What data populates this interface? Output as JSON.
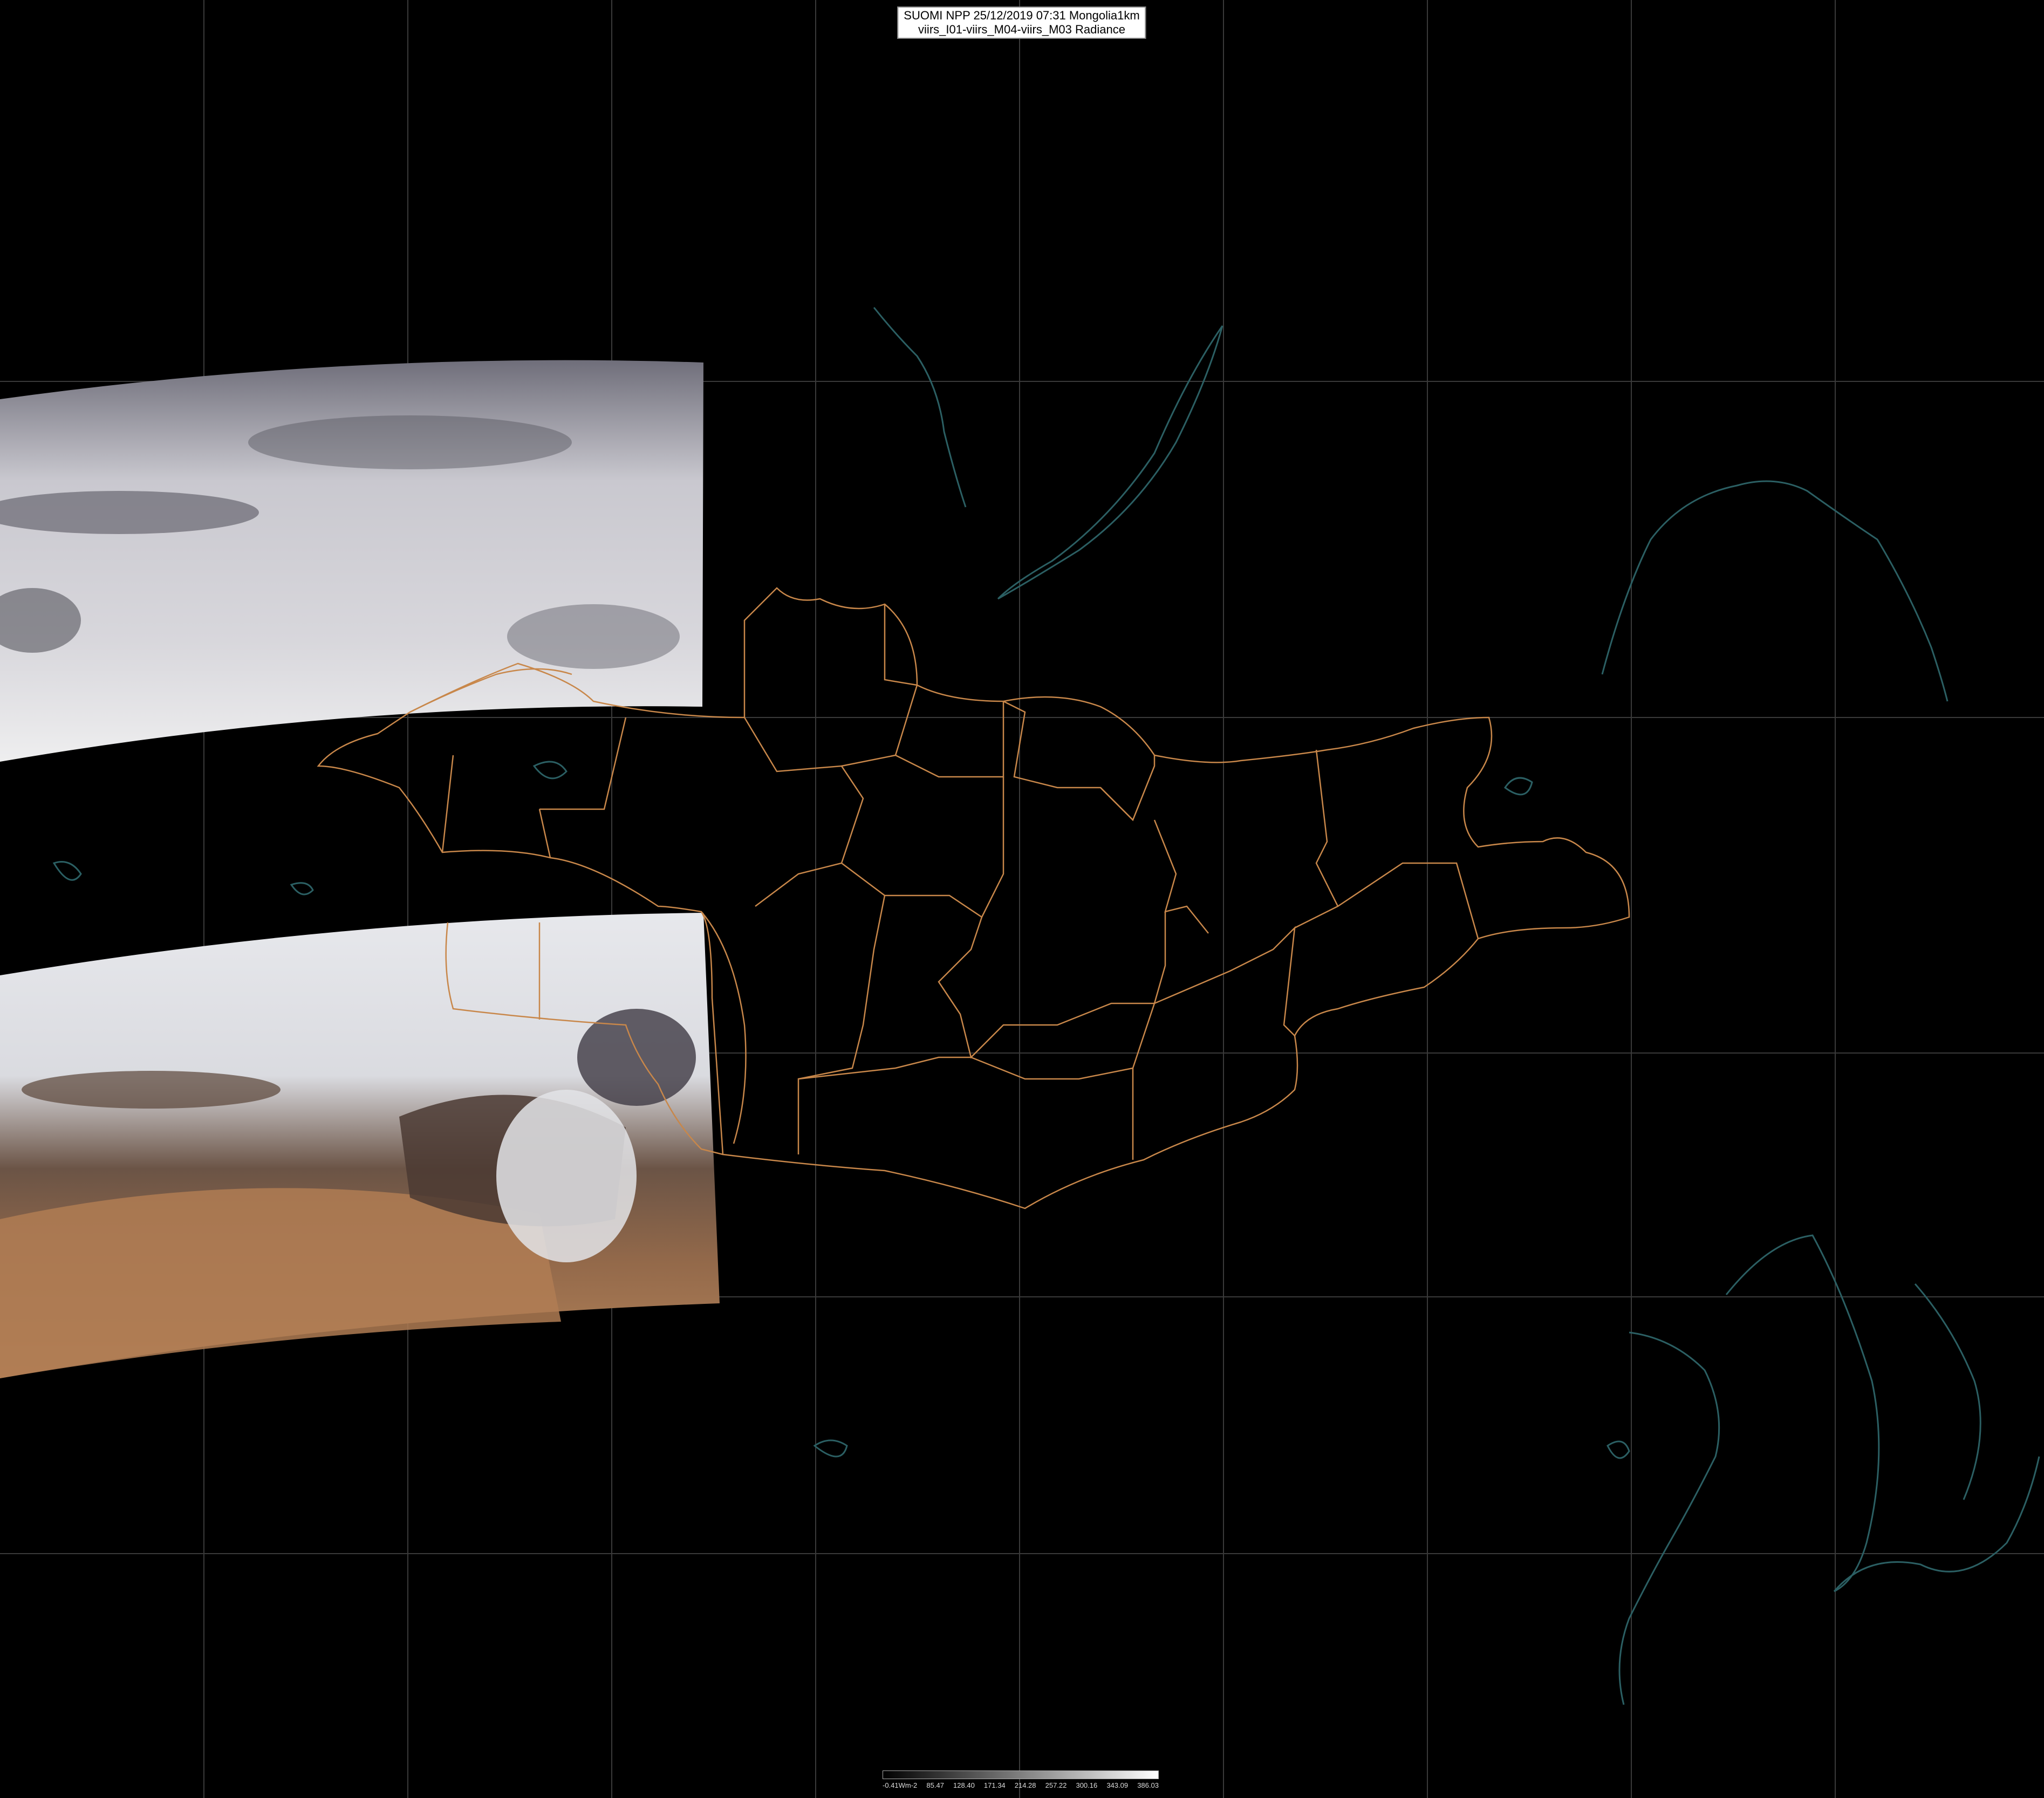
{
  "header": {
    "line1": "SUOMI NPP 25/12/2019 07:31 Mongolia1km",
    "line2": "viirs_I01-viirs_M04-viirs_M03 Radiance"
  },
  "legend": {
    "labels": [
      "-0.41Wm-2",
      "85.47",
      "128.40",
      "171.34",
      "214.28",
      "257.22",
      "300.16",
      "343.09",
      "386.03"
    ]
  },
  "colors": {
    "background": "#000000",
    "graticule": "#3a3a3a",
    "admin_border": "#c8874a",
    "coastline": "#2b5f63",
    "cloud": "#cfcfd6",
    "desert": "#a97a4e"
  }
}
